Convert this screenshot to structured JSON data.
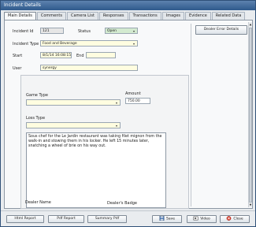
{
  "window": {
    "title": "Incident Details"
  },
  "tabs": [
    "Main Details",
    "Comments",
    "Camera List",
    "Responses",
    "Transactions",
    "Images",
    "Evidence",
    "Related Data"
  ],
  "form": {
    "incident_id_label": "Incident Id",
    "incident_id_value": "121",
    "status_label": "Status",
    "status_value": "Open",
    "incident_type_label": "Incident Type",
    "incident_type_value": "Food and Beverage",
    "start_label": "Start",
    "start_value": "8/1/14 16:08:15",
    "end_label": "End",
    "end_value": "",
    "user_label": "User",
    "user_value": "synergy"
  },
  "details": {
    "game_type_label": "Game Type",
    "game_type_value": "",
    "amount_label": "Amount",
    "amount_value": "750.00",
    "loss_type_label": "Loss Type",
    "loss_type_value": "",
    "description": "Sous chef for the Le Jardin restaurant was taking filet mignon from the walk-in and stowing them in his locker. He left 15 minutes later, snatching a wheel of brie on his way out.",
    "dealer_name_label": "Dealer Name",
    "dealers_badge_label": "Dealer's Badge"
  },
  "sidebar": {
    "dealer_error_button": "Dealer Error Details"
  },
  "bottom": {
    "html_report": "Html Report",
    "pdf_report": "Pdf Report",
    "summary_pdf": "Summary Pdf",
    "save": "Save",
    "video": "Video",
    "close": "Close"
  },
  "icons": [
    "dropdown-arrow-icon",
    "save-icon",
    "video-icon",
    "close-icon",
    "scroll-up-icon",
    "scroll-down-icon"
  ],
  "colors": {
    "titlebar": "#2f5a8c",
    "field_bg": "#fffde0",
    "status_bg": "#d3ead0"
  }
}
